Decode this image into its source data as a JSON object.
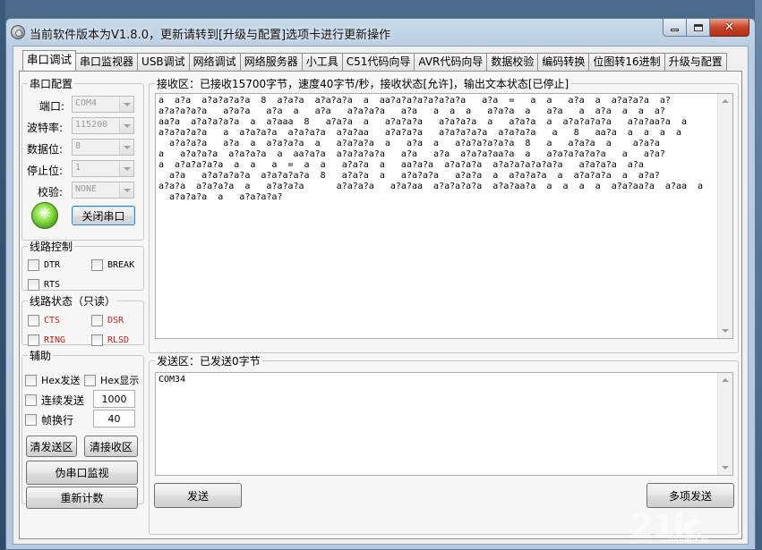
{
  "window": {
    "title": "当前软件版本为V1.8.0，更新请转到[升级与配置]选项卡进行更新操作"
  },
  "tabs": [
    {
      "label": "串口调试"
    },
    {
      "label": "串口监视器"
    },
    {
      "label": "USB调试"
    },
    {
      "label": "网络调试"
    },
    {
      "label": "网络服务器"
    },
    {
      "label": "小工具"
    },
    {
      "label": "C51代码向导"
    },
    {
      "label": "AVR代码向导"
    },
    {
      "label": "数据校验"
    },
    {
      "label": "编码转换"
    },
    {
      "label": "位图转16进制"
    },
    {
      "label": "升级与配置"
    }
  ],
  "serial_config": {
    "legend": "串口配置",
    "port_label": "端口:",
    "port_value": "COM4",
    "baud_label": "波特率:",
    "baud_value": "115200",
    "databits_label": "数据位:",
    "databits_value": "8",
    "stopbits_label": "停止位:",
    "stopbits_value": "1",
    "parity_label": "校验:",
    "parity_value": "NONE",
    "toggle_button": "关闭串口"
  },
  "line_control": {
    "legend": "线路控制",
    "dtr": "DTR",
    "break": "BREAK",
    "rts": "RTS"
  },
  "line_status": {
    "legend": "线路状态（只读）",
    "cts": "CTS",
    "dsr": "DSR",
    "ring": "RING",
    "rlsd": "RLSD"
  },
  "assist": {
    "legend": "辅助",
    "hex_send": "Hex发送",
    "hex_display": "Hex显示",
    "continuous_send": "连续发送",
    "continuous_interval": "1000",
    "frame_newline": "帧换行",
    "frame_value": "40",
    "clear_send": "清发送区",
    "clear_receive": "清接收区",
    "pseudo_monitor": "伪串口监视",
    "reset_count": "重新计数"
  },
  "receive": {
    "legend": "接收区：已接收15700字节，速度40字节/秒，接收状态[允许]，输出文本状态[已停止]",
    "lines": [
      "a  a?a  a?a?a?a?a  8  a?a?a  a?a?a?a  a  aa?a?a?a?a?a?a?a   a?a  =   a  a   a?a  a  a?a?a?a  a?",
      "a?a?a?a?a   a?a?a   a?a  a   a?a   a?a?a?a   a?a   a  a  a   a?a?a  a   a?a   a  a?a  a  a  a?",
      "aa?a  a?a?a?a?a  a  a?aaa  8   a?a?a  a   a?a?a?a   a?a?a?a  a   a?a?a  a  a?a?a?a?a   a?a?aa?a  a",
      "a?a?a?a?a   a  a?a?a?a  a?a?a?a  a?a?aa   a?a?a?a   a?a?a?a?a  a?a?a?a   a   8   aa?a  a  a  a  a",
      "  a?a?a?a   a?a  a  a?a?a?a  a   a?a?a?a  a   a?a  a   a?a?a?a?a?a  8   a   a?a?a  a    a?a?a",
      "a   a?a?a?a  a?a?a?a  a  aa?a?a  a?a?a?a?a   a?a   a?a  a?a?a?aa?a  a   a?a?a?a?a?a   a   a?a?",
      "a  a?a?a?a?a  a  a   a  =  a  a   a?a?a  a   aa?a?a  a?a?a?a  a?a?a?a?a?a?a   a?a?a?a  a?a",
      "  a?a   a?a?a?a?a  a?a?a?a?a  8   a?a?a  a   a?a?a?a   a?a?a  a  a?a?a?a  a  a?a?a?a  a  a?a?",
      "a?a?a  a?a?a?a  a   a?a?a?a      a?a?a?a   a?a?aa  a?a?a?a?a  a?a?aa?a  a  a  a  a  a?a?aa?a  a?aa  a",
      "  a?a?a?a  a   a?a?a?a?"
    ]
  },
  "send": {
    "legend": "发送区：已发送0字节",
    "content": "COM34",
    "send_button": "发送",
    "multi_send_button": "多项发送"
  },
  "watermark": {
    "logo_text": "21ic",
    "sub_text": "中国电子网"
  }
}
